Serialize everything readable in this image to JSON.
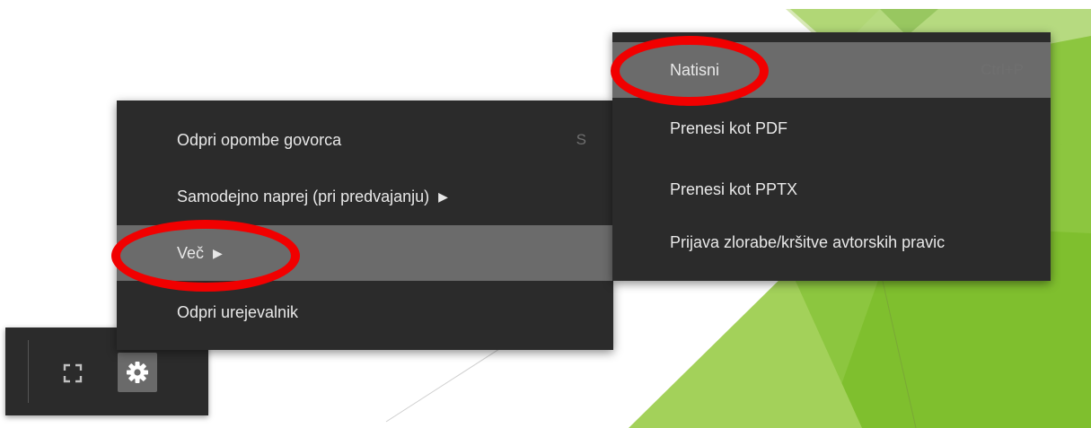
{
  "main_menu": {
    "items": [
      {
        "label": "Odpri opombe govorca",
        "shortcut": "S",
        "submenu": false
      },
      {
        "label": "Samodejno naprej (pri predvajanju)",
        "submenu": true,
        "arrow": "▶"
      },
      {
        "label": "Več",
        "submenu": true,
        "arrow": "▶",
        "active": true
      },
      {
        "label": "Odpri urejevalnik",
        "submenu": false
      }
    ]
  },
  "sub_menu": {
    "items": [
      {
        "label": "Natisni",
        "shortcut": "Ctrl+P",
        "active": true
      },
      {
        "label": "Prenesi kot PDF"
      },
      {
        "label": "Prenesi kot PPTX"
      },
      {
        "label": "Prijava zlorabe/kršitve avtorskih pravic"
      }
    ]
  },
  "toolbar": {
    "fullscreen_icon": "fullscreen-icon",
    "settings_icon": "gear-icon"
  },
  "colors": {
    "menu_bg": "#2b2b2b",
    "active_bg": "#6b6b6b",
    "highlight_ring": "#f10000",
    "slide_green": "#8cc63f"
  }
}
